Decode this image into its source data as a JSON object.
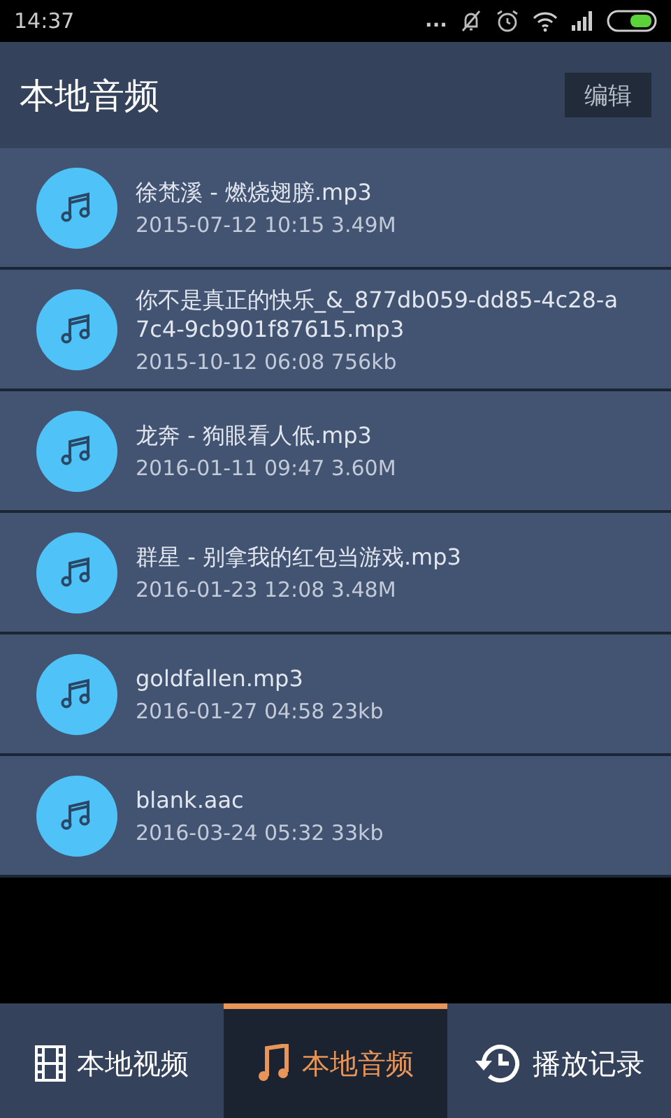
{
  "status_bar": {
    "time": "14:37",
    "dots": "..."
  },
  "header": {
    "title": "本地音频",
    "edit_button": "编辑"
  },
  "files": [
    {
      "name": "徐梵溪 - 燃烧翅膀.mp3",
      "meta": "2015-07-12 10:15  3.49M"
    },
    {
      "name": "你不是真正的快乐_&_877db059-dd85-4c28-a7c4-9cb901f87615.mp3",
      "meta": "2015-10-12 06:08  756kb"
    },
    {
      "name": "龙奔 - 狗眼看人低.mp3",
      "meta": "2016-01-11 09:47  3.60M"
    },
    {
      "name": "群星 - 别拿我的红包当游戏.mp3",
      "meta": "2016-01-23 12:08  3.48M"
    },
    {
      "name": "goldfallen.mp3",
      "meta": "2016-01-27 04:58  23kb"
    },
    {
      "name": "blank.aac",
      "meta": "2016-03-24 05:32  33kb"
    }
  ],
  "tabs": [
    {
      "label": "本地视频",
      "kind": "video",
      "selected": false
    },
    {
      "label": "本地音频",
      "kind": "audio",
      "selected": true
    },
    {
      "label": "播放记录",
      "kind": "history",
      "selected": false
    }
  ]
}
